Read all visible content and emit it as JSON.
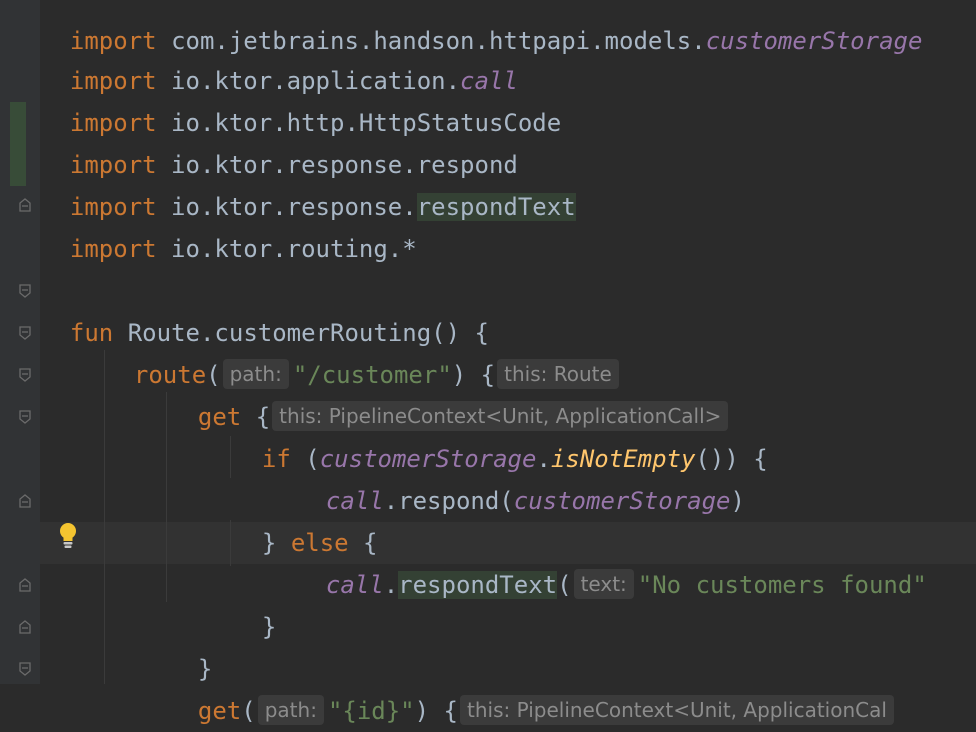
{
  "editor": {
    "lines": [
      {
        "id": "import0",
        "parts": [
          "import ",
          "com.jetbrains.handson.httpapi.models.",
          "customerStorage"
        ]
      },
      {
        "id": "import1",
        "kw": "import",
        "pkg": " io.ktor.application.",
        "name": "call"
      },
      {
        "id": "import2",
        "kw": "import",
        "pkg": " io.ktor.http.HttpStatusCode"
      },
      {
        "id": "import3",
        "kw": "import",
        "pkg": " io.ktor.response.respond"
      },
      {
        "id": "import4",
        "kw": "import",
        "pkg": " io.ktor.response.",
        "name": "respondText"
      },
      {
        "id": "import5",
        "kw": "import",
        "pkg": " io.ktor.routing.*"
      }
    ],
    "fun_kw": "fun",
    "receiver": " Route.",
    "fun_name": "customerRouting",
    "fun_tail": "() {",
    "route_name": "route",
    "route_open": "(",
    "hint_path": "path:",
    "route_path": "\"/customer\"",
    "route_close": ") {",
    "hint_this_route": "this: Route",
    "get_name": "get",
    "brace_open": " {",
    "hint_this_pipeline": "this: PipelineContext<Unit, ApplicationCall>",
    "if_kw": "if",
    "if_open": " (",
    "customer_storage": "customerStorage",
    "dot": ".",
    "is_not_empty": "isNotEmpty",
    "if_tail": "()) {",
    "call": "call",
    "respond_tail": ".respond(",
    "respond_close": ")",
    "else_open": "} ",
    "else_kw": "else",
    "else_tail": " {",
    "respond_text": "respondText",
    "paren_open": "(",
    "hint_text": "text:",
    "no_customers": "\"No customers found\"",
    "close_brace": "}",
    "get_id_path": "\"{id}\"",
    "get_id_close": ") {",
    "hint_this_pipeline_cut": "this: PipelineContext<Unit, ApplicationCal"
  },
  "colors": {
    "background": "#2b2b2b",
    "keyword": "#cc7832",
    "string": "#6a8759",
    "field": "#9876aa",
    "function": "#ffc66d",
    "text": "#a9b7c6"
  },
  "icons": [
    "lightbulb-icon",
    "fold-icon"
  ]
}
